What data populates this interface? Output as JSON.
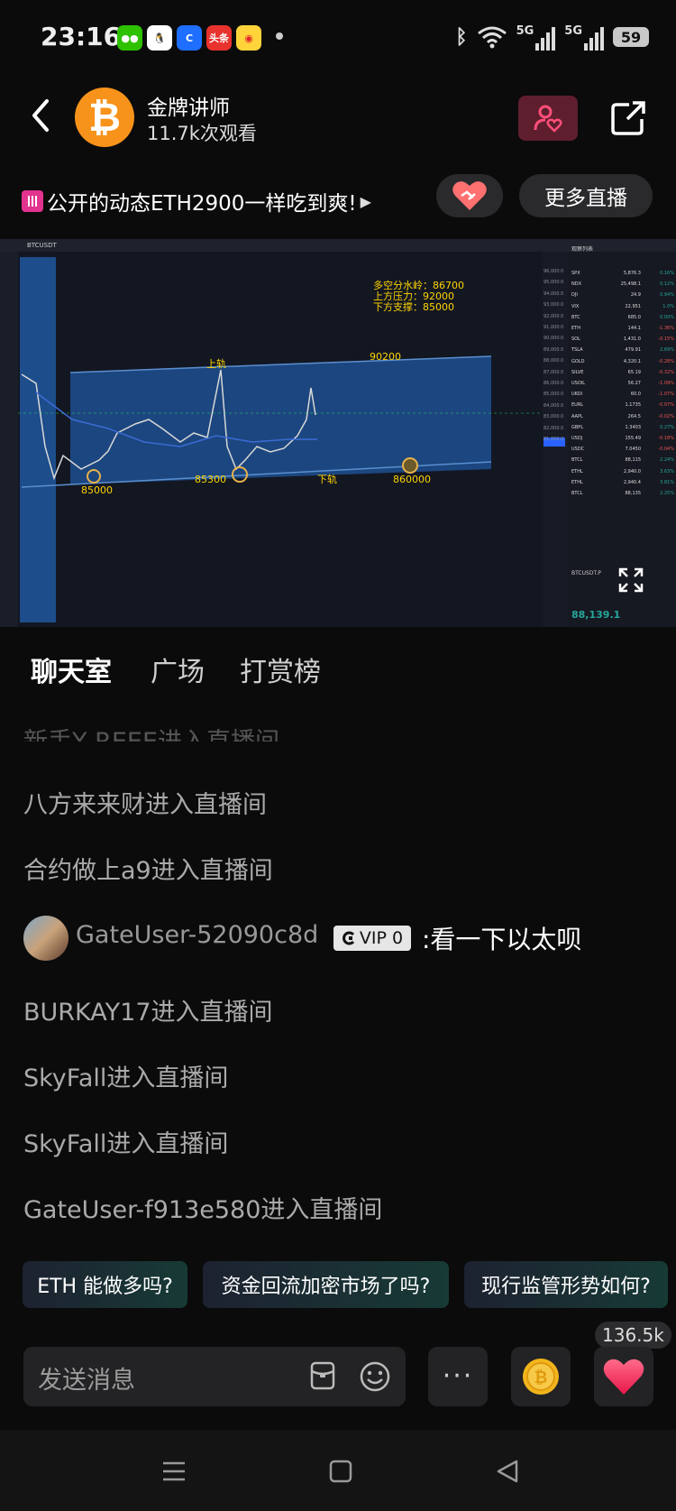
{
  "status_bar": {
    "time": "23:16",
    "apps": [
      "wechat-icon",
      "qq-icon",
      "browser-icon",
      "toutiao-icon",
      "weibo-icon"
    ],
    "toutiao_label": "头条",
    "network1": "5G",
    "network2": "5G",
    "battery": "59"
  },
  "header": {
    "host_name": "金牌讲师",
    "viewers": "11.7k次观看"
  },
  "topic": {
    "text": "公开的动态ETH2900一样吃到爽!",
    "more_live": "更多直播"
  },
  "video": {
    "symbol": "BTCUSDT",
    "annotation_lines": [
      "多空分水岭：86700",
      "上方压力：92000",
      "下方支撑：85000"
    ],
    "label_upper_rail": "上轨",
    "label_lower_rail": "下轨",
    "level_90200": "90200",
    "level_85000": "85000",
    "level_85300": "85300",
    "level_860000": "860000",
    "price_axis": [
      "96,000.0",
      "95,000.0",
      "94,000.0",
      "93,000.0",
      "92,000.0",
      "91,000.0",
      "90,000.0",
      "89,000.0",
      "88,000.0",
      "87,000.0",
      "86,000.0",
      "85,000.0",
      "84,000.0",
      "83,000.0",
      "82,000.0",
      "81,000.0"
    ],
    "current_price_tag": "88,139.1",
    "watchlist_title": "观察列表",
    "watchlist": [
      {
        "sym": "SPX",
        "val": "5,876.3",
        "chg": "0.16%",
        "up": true
      },
      {
        "sym": "NDX",
        "val": "25,498.1",
        "chg": "0.12%",
        "up": true
      },
      {
        "sym": "DJI",
        "val": "24.9",
        "chg": "0.94%",
        "up": true
      },
      {
        "sym": "VIX",
        "val": "22,951",
        "chg": "1.0%",
        "up": true
      },
      {
        "sym": "BTC",
        "val": "685.0",
        "chg": "0.00%",
        "up": true
      },
      {
        "sym": "ETH",
        "val": "144.1",
        "chg": "-1.36%",
        "up": false
      },
      {
        "sym": "SOL",
        "val": "1,431.0",
        "chg": "-0.15%",
        "up": false
      },
      {
        "sym": "TSLA",
        "val": "479.91",
        "chg": "2.69%",
        "up": true
      },
      {
        "sym": "GOLD",
        "val": "4,320.1",
        "chg": "-0.28%",
        "up": false
      },
      {
        "sym": "SILVE",
        "val": "65.19",
        "chg": "-0.32%",
        "up": false
      },
      {
        "sym": "USOIL",
        "val": "56.27",
        "chg": "-1.09%",
        "up": false
      },
      {
        "sym": "UKOI",
        "val": "60.0",
        "chg": "-1.07%",
        "up": false
      },
      {
        "sym": "EURL",
        "val": "1.1735",
        "chg": "-0.07%",
        "up": false
      },
      {
        "sym": "AAPL",
        "val": "264.5",
        "chg": "-0.02%",
        "up": false
      },
      {
        "sym": "GBPL",
        "val": "1.3403",
        "chg": "0.27%",
        "up": true
      },
      {
        "sym": "USDJ",
        "val": "155.49",
        "chg": "-0.18%",
        "up": false
      },
      {
        "sym": "USDC",
        "val": "7.0450",
        "chg": "-0.04%",
        "up": false
      },
      {
        "sym": "BTCL",
        "val": "88,115",
        "chg": "2.24%",
        "up": true
      },
      {
        "sym": "ETHL",
        "val": "2,940.0",
        "chg": "3.63%",
        "up": true
      },
      {
        "sym": "ETHL",
        "val": "2,940.4",
        "chg": "3.81%",
        "up": true
      },
      {
        "sym": "BTCL",
        "val": "88,135",
        "chg": "2.25%",
        "up": true
      }
    ],
    "detail_symbol": "BTCUSDT.P",
    "detail_price": "88,139.1"
  },
  "tabs": [
    "聊天室",
    "广场",
    "打赏榜"
  ],
  "chat": {
    "faded_line": "新手Y REEE进入直播间",
    "lines_top": [
      "八方来来财进入直播间",
      "合约做上a9进入直播间"
    ],
    "message": {
      "username": "GateUser-52090c8d",
      "vip": "VIP 0",
      "text": ":看一下以太呗"
    },
    "lines_bottom": [
      "BURKAY17进入直播间",
      "SkyFall进入直播间",
      "SkyFall进入直播间",
      "GateUser-f913e580进入直播间"
    ]
  },
  "suggestions": [
    "ETH 能做多吗?",
    "资金回流加密市场了吗?",
    "现行监管形势如何?"
  ],
  "input": {
    "placeholder": "发送消息",
    "likes_count": "136.5k"
  }
}
